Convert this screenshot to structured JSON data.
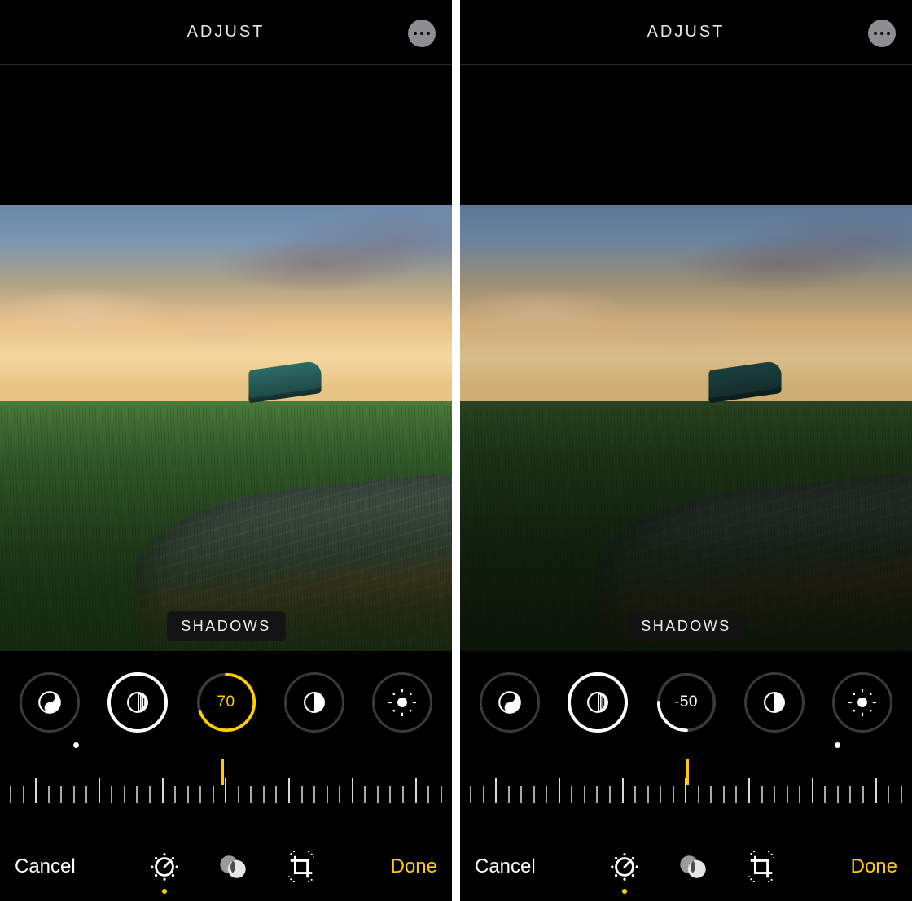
{
  "colors": {
    "accent": "#ffcc00",
    "text": "#ffffff",
    "ring_inactive": "#3a3a3a"
  },
  "icons": {
    "more": "more-icon",
    "dial_blacks": "yin-yang-icon",
    "dial_shadows_tool": "half-shaded-circle-icon",
    "dial_contrast": "half-circle-icon",
    "dial_brightness": "sun-icon",
    "footer_adjust": "adjust-dial-icon",
    "footer_filters": "filters-overlap-icon",
    "footer_crop": "crop-rotate-icon"
  },
  "screens": [
    {
      "header": {
        "title": "ADJUST"
      },
      "tool_badge": "SHADOWS",
      "dials": {
        "active_value": "70",
        "value_color": "#ffcc00",
        "ring_progress_deg": 252,
        "ring_color": "#ffcc00"
      },
      "dot_position_pct": 13,
      "pointer_left_pct": 49,
      "footer": {
        "cancel": "Cancel",
        "done": "Done",
        "selected": "adjust"
      },
      "photo_variant": "bright"
    },
    {
      "header": {
        "title": "ADJUST"
      },
      "tool_badge": "SHADOWS",
      "dials": {
        "active_value": "-50",
        "value_color": "#ffffff",
        "ring_progress_deg": 90,
        "ring_color": "#ffffff"
      },
      "dot_position_pct": 86,
      "pointer_left_pct": 50,
      "footer": {
        "cancel": "Cancel",
        "done": "Done",
        "selected": "adjust"
      },
      "photo_variant": "dark"
    }
  ],
  "scale": {
    "ticks": 35,
    "tall_every": 5
  }
}
